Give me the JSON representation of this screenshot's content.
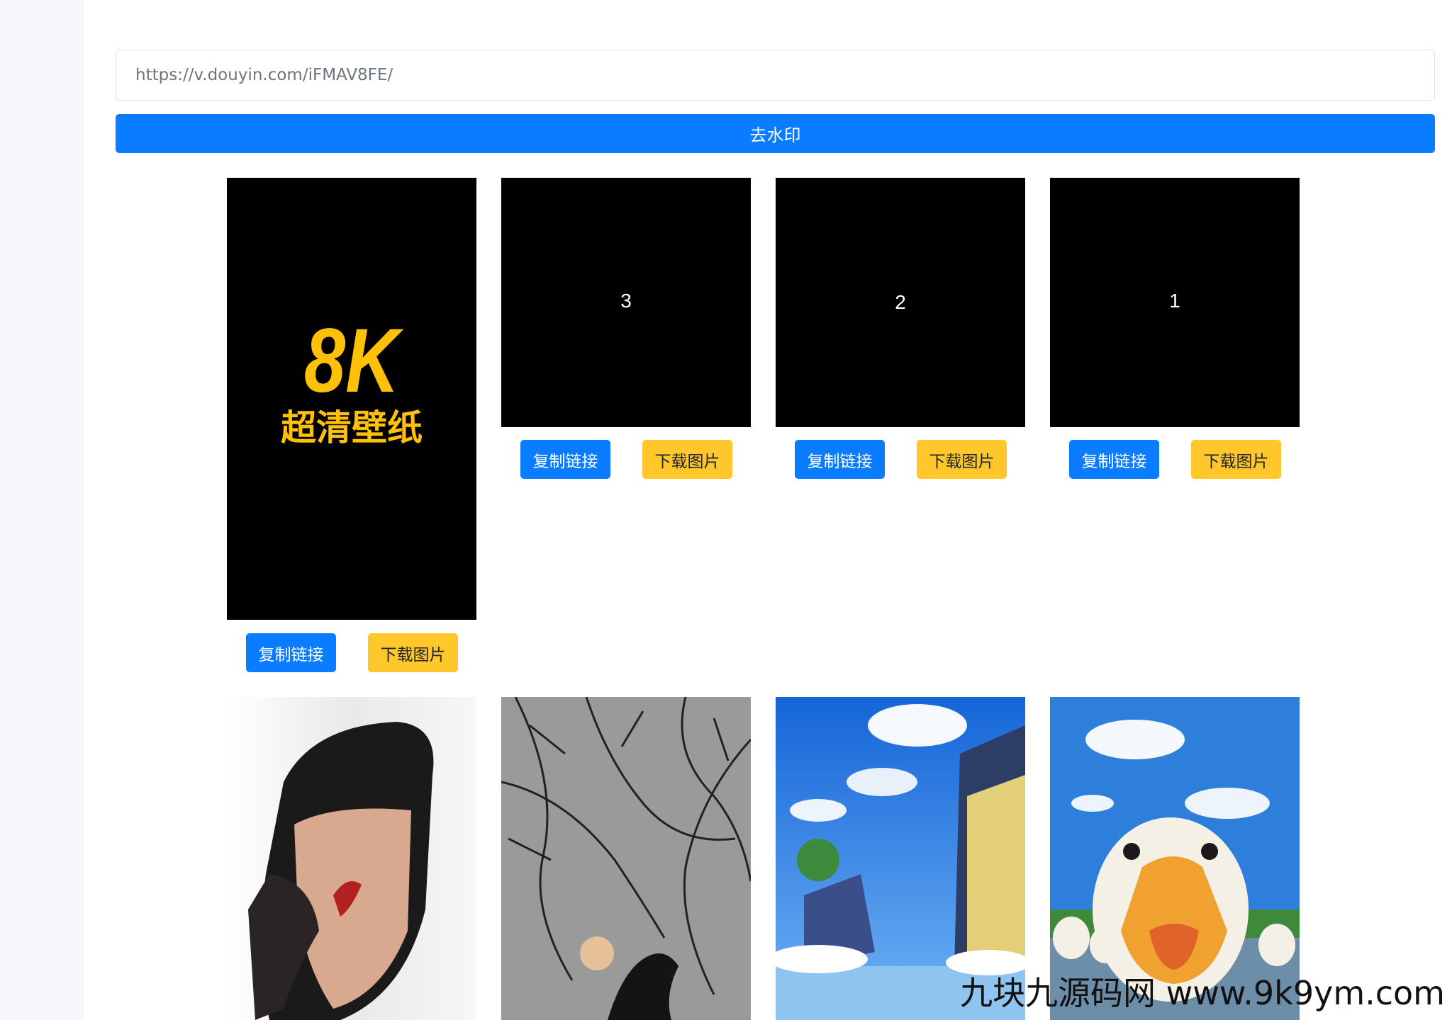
{
  "search": {
    "value": "https://v.douyin.com/iFMAV8FE/"
  },
  "submit_button": {
    "label": "去水印"
  },
  "cover": {
    "big_text": "8K",
    "sub_text": "超清壁纸",
    "big_color": "#ffc107"
  },
  "tiles": [
    {
      "label": "3"
    },
    {
      "label": "2"
    },
    {
      "label": "1"
    }
  ],
  "actions": {
    "copy_label": "复制链接",
    "download_label": "下载图片"
  },
  "watermark": {
    "text": "九块九源码网 www.9k9ym.com"
  },
  "colors": {
    "primary": "#0a7cff",
    "warning": "#ffc72c"
  }
}
